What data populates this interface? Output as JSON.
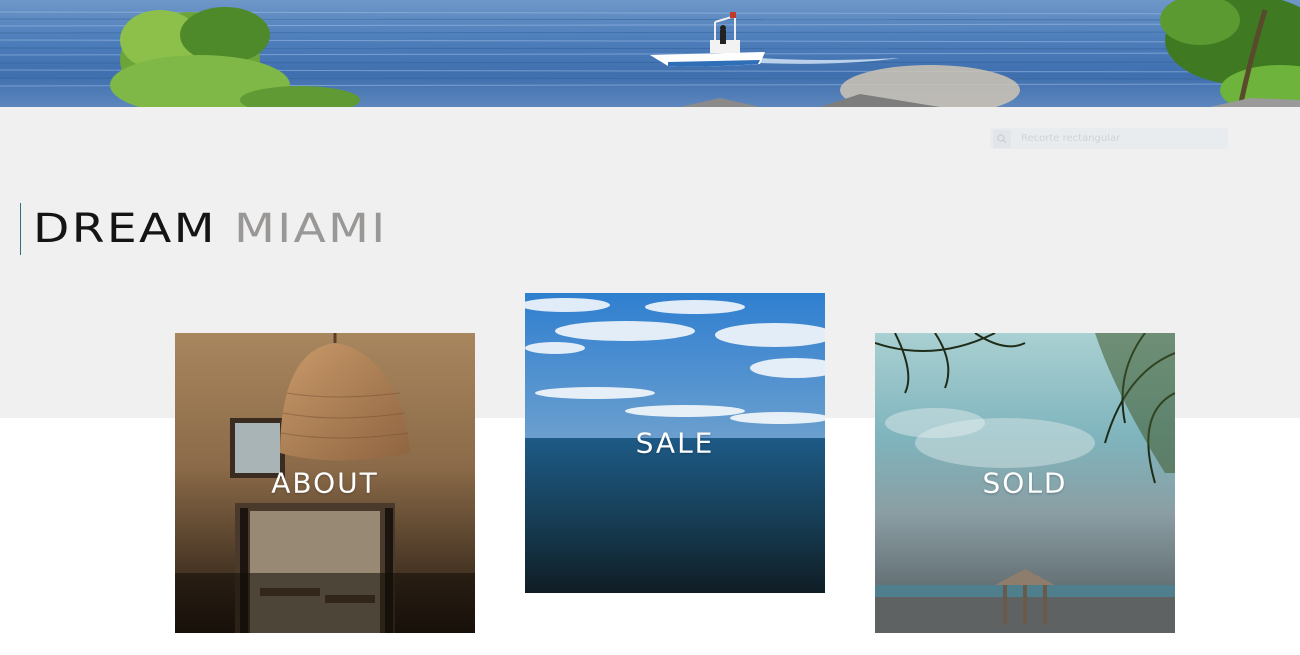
{
  "hero": {
    "image": "waterfront-banner-with-boat-and-palms"
  },
  "search": {
    "placeholder": "Recorte rectangular",
    "icon": "search-icon"
  },
  "brand": {
    "word1": "DREAM",
    "word2": "MIAMI",
    "colors": {
      "word1": "#141414",
      "word2": "#9a9896",
      "accent_rule": "#2e6f7d"
    }
  },
  "tiles": [
    {
      "label": "ABOUT",
      "image": "wicker-pendant-lamp-interior"
    },
    {
      "label": "SALE",
      "image": "ocean-horizon-blue-sky"
    },
    {
      "label": "SOLD",
      "image": "beach-gazebo-with-palms"
    }
  ],
  "colors": {
    "band": "#f0f0f0",
    "page": "#ffffff",
    "tile_text": "#ffffff"
  }
}
